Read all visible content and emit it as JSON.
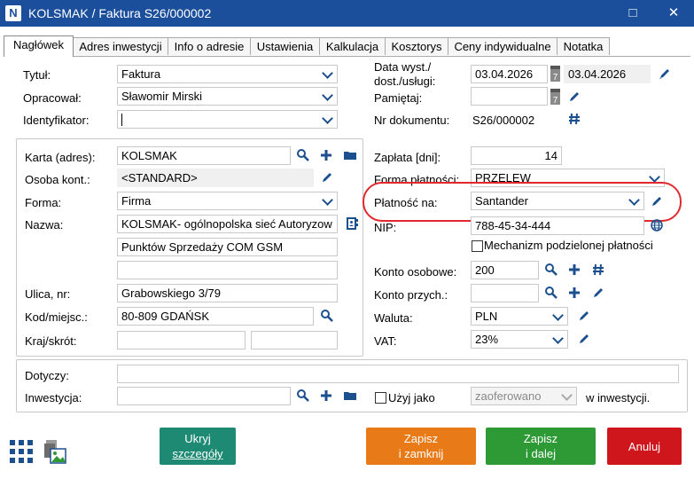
{
  "window": {
    "title": "KOLSMAK / Faktura S26/000002",
    "app_icon": "N",
    "maximize_glyph": "□",
    "close_glyph": "✕"
  },
  "tabs": [
    "Nagłówek",
    "Adres inwestycji",
    "Info o adresie",
    "Ustawienia",
    "Kalkulacja",
    "Kosztorys",
    "Ceny indywidualne",
    "Notatka"
  ],
  "header": {
    "tytul_label": "Tytuł:",
    "tytul_value": "Faktura",
    "opracowal_label": "Opracował:",
    "opracowal_value": "Sławomir Mirski",
    "identyfikator_label": "Identyfikator:",
    "identyfikator_value": "",
    "data_label_1": "Data wyst./",
    "data_label_2": "dost./usługi:",
    "data_wyst": "03.04.2026",
    "data_dost": "03.04.2026",
    "date_picker_glyph": "7",
    "pamietaj_label": "Pamiętaj:",
    "pamietaj_value": "",
    "nr_label": "Nr dokumentu:",
    "nr_value": "S26/000002"
  },
  "client": {
    "karta_label": "Karta (adres):",
    "karta_value": "KOLSMAK",
    "osoba_label": "Osoba kont.:",
    "osoba_value": "<STANDARD>",
    "forma_label": "Forma:",
    "forma_value": "Firma",
    "nazwa_label": "Nazwa:",
    "nazwa_1": "KOLSMAK- ogólnopolska sieć Autoryzow",
    "nazwa_2": "Punktów Sprzedaży COM GSM",
    "nazwa_3": "",
    "ulica_label": "Ulica, nr:",
    "ulica_value": "Grabowskiego 3/79",
    "kod_label": "Kod/miejsc.:",
    "kod_value": "80-809 GDAŃSK",
    "kraj_label": "Kraj/skrót:",
    "kraj_value": "",
    "skrot_value": ""
  },
  "payment": {
    "zaplata_label": "Zapłata [dni]:",
    "zaplata_value": "14",
    "forma_platnosci_label": "Forma płatności:",
    "forma_platnosci_value": "PRZELEW",
    "platnosc_na_label": "Płatność na:",
    "platnosc_na_value": "Santander",
    "nip_label": "NIP:",
    "nip_value": "788-45-34-444",
    "mpp_label": "Mechanizm podzielonej płatności",
    "mpp_checked": false,
    "konto_os_label": "Konto osobowe:",
    "konto_os_value": "200",
    "konto_przych_label": "Konto przych.:",
    "konto_przych_value": "",
    "waluta_label": "Waluta:",
    "waluta_value": "PLN",
    "vat_label": "VAT:",
    "vat_value": "23%"
  },
  "bottom": {
    "dotyczy_label": "Dotyczy:",
    "dotyczy_value": "",
    "inwestycja_label": "Inwestycja:",
    "inwestycja_value": "",
    "uzyj_label": "Użyj jako",
    "uzyj_checked": false,
    "status_value": "zaoferowano",
    "w_inwestycji_label": "w inwestycji."
  },
  "buttons": {
    "ukryj_1": "Ukryj",
    "ukryj_2": "szczegóły",
    "zapisz_zamknij_1": "Zapisz",
    "zapisz_zamknij_2": "i zamknij",
    "zapisz_dalej_1": "Zapisz",
    "zapisz_dalej_2": "i dalej",
    "anuluj": "Anuluj"
  },
  "colors": {
    "titlebar": "#1b4f9c",
    "accent_icon": "#1c4f8e",
    "ukryj": "#1e8a73",
    "zapisz_zamknij": "#e87a18",
    "zapisz_dalej": "#2e9a35",
    "anuluj": "#d0161d",
    "highlight": "#e0282e"
  }
}
